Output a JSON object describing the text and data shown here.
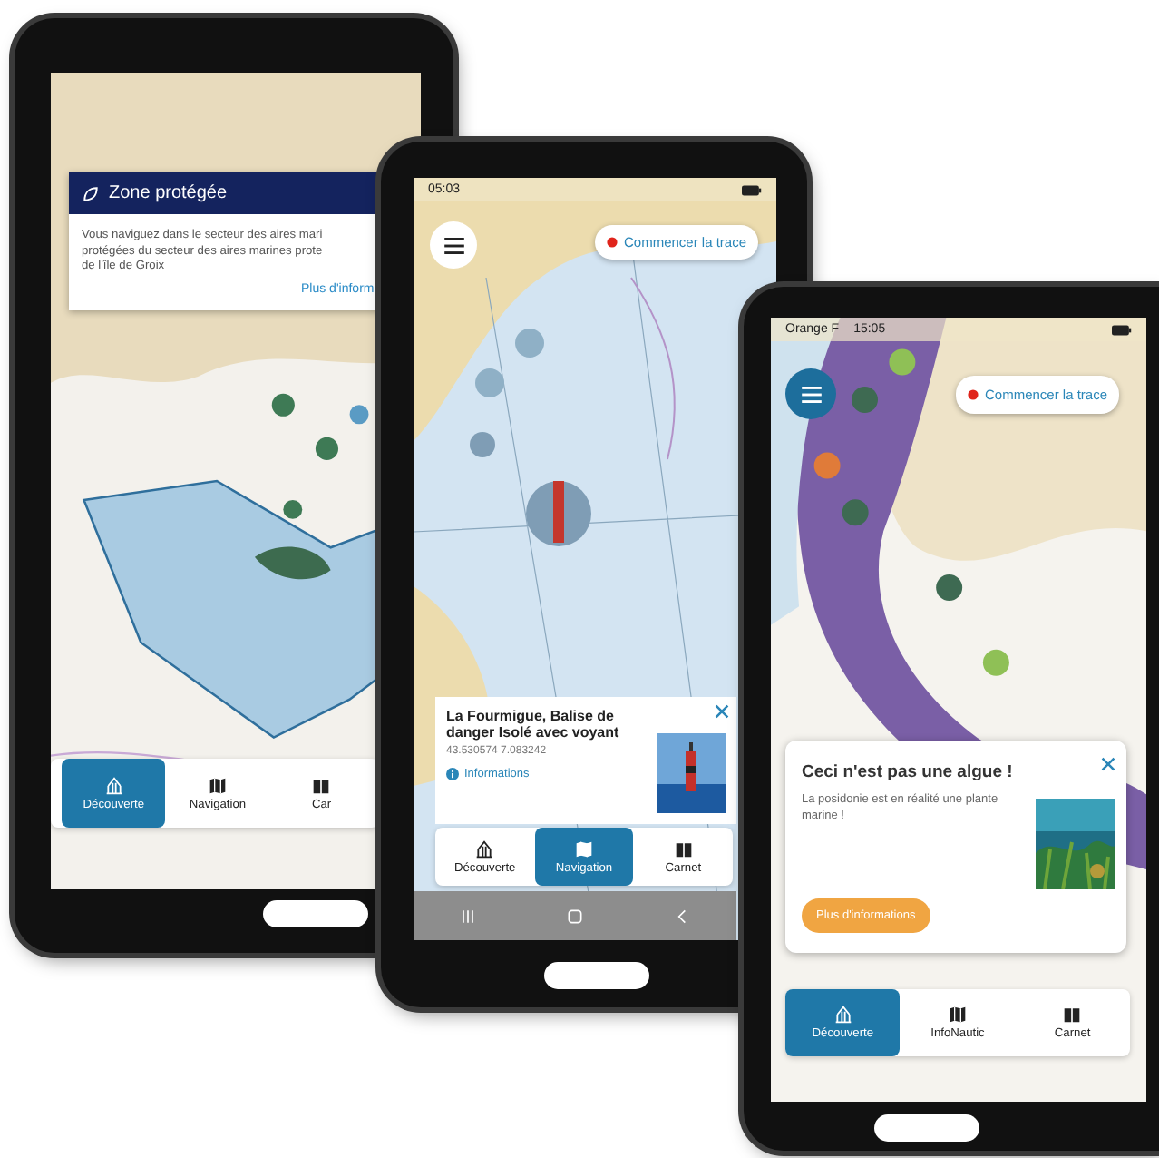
{
  "phones": [
    {
      "alert": {
        "title": "Zone protégée",
        "lines": [
          "Vous naviguez dans le secteur des aires mari",
          "protégées du secteur des aires marines prote",
          "de l'île de Groix"
        ],
        "link": "Plus d'inform"
      },
      "nav_tabs": [
        {
          "kind": "discover",
          "label": "Découverte",
          "selected": true
        },
        {
          "kind": "map",
          "label": "Navigation",
          "selected": false
        },
        {
          "kind": "book",
          "label": "Car",
          "selected": false
        }
      ]
    },
    {
      "status_bar": {
        "time": "05:03"
      },
      "menu_button": true,
      "trace_button": "Commencer la trace",
      "place_card": {
        "title": "La Fourmigue, Balise de danger Isolé avec voyant",
        "coords": "43.530574 7.083242",
        "link": "Informations"
      },
      "nav_tabs": [
        {
          "kind": "discover",
          "label": "Découverte",
          "selected": false
        },
        {
          "kind": "map",
          "label": "Navigation",
          "selected": true
        },
        {
          "kind": "book",
          "label": "Carnet",
          "selected": false
        }
      ],
      "system_nav": true
    },
    {
      "status_bar": {
        "carrier": "Orange F",
        "time": "15:05"
      },
      "menu_button": true,
      "trace_button": "Commencer la trace",
      "tip_card": {
        "title": "Ceci n'est pas une algue !",
        "text": "La posidonie est en réalité une plante marine !",
        "button": "Plus d'informations"
      },
      "nav_tabs": [
        {
          "kind": "discover",
          "label": "Découverte",
          "selected": true
        },
        {
          "kind": "map",
          "label": "InfoNautic",
          "selected": false
        },
        {
          "kind": "book",
          "label": "Carnet",
          "selected": false
        }
      ]
    }
  ]
}
